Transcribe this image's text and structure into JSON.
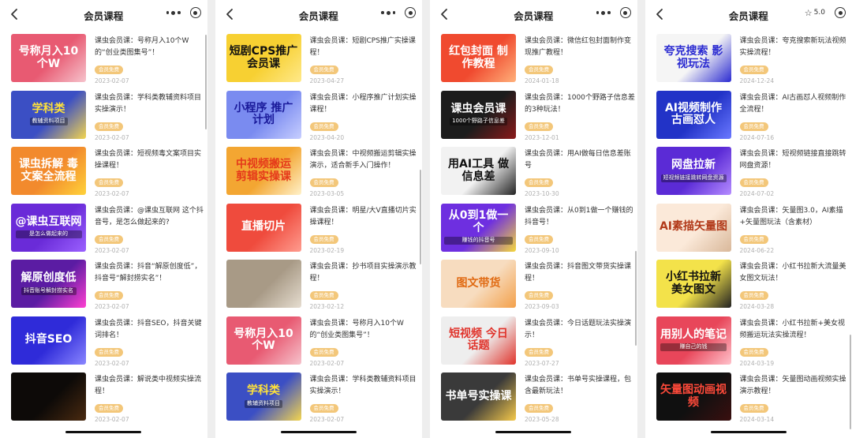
{
  "panels": [
    {
      "title": "会员课程",
      "rating": null,
      "scroll": 0.0,
      "items": [
        {
          "desc": "课虫会员课：号称月入10个W的“创业类图集号”！",
          "tag": "会员免费",
          "date": "2023-02-07",
          "thumb_text": "号称月入10个W",
          "thumb_sub": "",
          "thumb_bg": "#e85a72",
          "thumb_bg2": "#f6c3cc",
          "thumb_fg": "#ffffff"
        },
        {
          "desc": "课虫会员课：学科类教辅资料项目实操演示！",
          "tag": "会员免费",
          "date": "2023-02-07",
          "thumb_text": "学科类",
          "thumb_sub": "教辅资料项目",
          "thumb_bg": "#3b4fc4",
          "thumb_bg2": "#f3d54e",
          "thumb_fg": "#ffe23a"
        },
        {
          "desc": "课虫会员课：短视频毒文案项目实操课程！",
          "tag": "会员免费",
          "date": "2023-02-07",
          "thumb_text": "课虫拆解 毒文案全流程",
          "thumb_sub": "",
          "thumb_bg": "#f28a2d",
          "thumb_bg2": "#ffd23a",
          "thumb_fg": "#ffffff"
        },
        {
          "desc": "课虫会员课：@课虫互联网 这个抖音号，是怎么做起来的?",
          "tag": "会员免费",
          "date": "2023-02-07",
          "thumb_text": "@课虫互联网",
          "thumb_sub": "是怎么做起来的",
          "thumb_bg": "#6a2bd8",
          "thumb_bg2": "#9b61ff",
          "thumb_fg": "#ffffff"
        },
        {
          "desc": "课虫会员课：抖音“解原创度低”，抖音号“解封捞实名”！",
          "tag": "会员免费",
          "date": "2023-02-07",
          "thumb_text": "解原创度低",
          "thumb_sub": "抖音账号解封捞实名",
          "thumb_bg": "#5b1ca3",
          "thumb_bg2": "#ff3fd1",
          "thumb_fg": "#ffffff"
        },
        {
          "desc": "课虫会员课：抖音SEO，抖音关键词排名！",
          "tag": "会员免费",
          "date": "2023-02-07",
          "thumb_text": "抖音SEO",
          "thumb_sub": "",
          "thumb_bg": "#2f2bd9",
          "thumb_bg2": "#8a86ff",
          "thumb_fg": "#ffffff"
        },
        {
          "desc": "课虫会员课：解说类中视频实操流程！",
          "tag": "会员免费",
          "date": "2023-02-07",
          "thumb_text": "",
          "thumb_sub": "",
          "thumb_bg": "#0d0a08",
          "thumb_bg2": "#4a2a10",
          "thumb_fg": "#ffffff"
        }
      ]
    },
    {
      "title": "会员课程",
      "rating": null,
      "scroll": 0.45,
      "items": [
        {
          "desc": "课虫会员课：短剧CPS推广实操课程！",
          "tag": "会员免费",
          "date": "2023-04-27",
          "thumb_text": "短剧CPS推广 会员课",
          "thumb_sub": "",
          "thumb_bg": "#f7d032",
          "thumb_bg2": "#ffe98a",
          "thumb_fg": "#111111"
        },
        {
          "desc": "课虫会员课：小程序推广计划实操课程！",
          "tag": "会员免费",
          "date": "2023-04-20",
          "thumb_text": "小程序 推广计划",
          "thumb_sub": "",
          "thumb_bg": "#7a8bf0",
          "thumb_bg2": "#c7ceff",
          "thumb_fg": "#1a1a9a"
        },
        {
          "desc": "课虫会员课：中视频搬运剪辑实操演示，适合新手入门操作！",
          "tag": "会员免费",
          "date": "2023-03-05",
          "thumb_text": "中视频搬运 剪辑实操课",
          "thumb_sub": "",
          "thumb_bg": "#f3a632",
          "thumb_bg2": "#fff1c9",
          "thumb_fg": "#e53a1a"
        },
        {
          "desc": "课虫会员课：明星/大V直播切片实操课程！",
          "tag": "会员免费",
          "date": "2023-02-19",
          "thumb_text": "直播切片",
          "thumb_sub": "",
          "thumb_bg": "#ef4b3d",
          "thumb_bg2": "#ff9c8f",
          "thumb_fg": "#ffffff"
        },
        {
          "desc": "课虫会员课：抄书项目实操演示教程！",
          "tag": "会员免费",
          "date": "2023-02-12",
          "thumb_text": "",
          "thumb_sub": "",
          "thumb_bg": "#a89a86",
          "thumb_bg2": "#e6ddd0",
          "thumb_fg": "#ffffff"
        },
        {
          "desc": "课虫会员课：号称月入10个W的“创业类图集号”！",
          "tag": "会员免费",
          "date": "2023-02-07",
          "thumb_text": "号称月入10个W",
          "thumb_sub": "",
          "thumb_bg": "#e85a72",
          "thumb_bg2": "#f6c3cc",
          "thumb_fg": "#ffffff"
        },
        {
          "desc": "课虫会员课：学科类教辅资料项目实操演示！",
          "tag": "会员免费",
          "date": "2023-02-07",
          "thumb_text": "学科类",
          "thumb_sub": "教辅资料项目",
          "thumb_bg": "#3b4fc4",
          "thumb_bg2": "#f3d54e",
          "thumb_fg": "#ffe23a"
        }
      ]
    },
    {
      "title": "会员课程",
      "rating": null,
      "scroll": 0.72,
      "items": [
        {
          "desc": "课虫会员课：微信红包封面制作变现推广教程！",
          "tag": "会员免费",
          "date": "2024-01-18",
          "thumb_text": "红包封面 制作教程",
          "thumb_sub": "",
          "thumb_bg": "#f04a2f",
          "thumb_bg2": "#ffb07a",
          "thumb_fg": "#ffffff"
        },
        {
          "desc": "课虫会员课：1000个野路子信息差的3种玩法！",
          "tag": "会员免费",
          "date": "2023-12-01",
          "thumb_text": "课虫会员课",
          "thumb_sub": "1000个野路子信息差",
          "thumb_bg": "#1c1c1c",
          "thumb_bg2": "#8b1a1a",
          "thumb_fg": "#ffffff"
        },
        {
          "desc": "课虫会员课：用AI做每日信息差账号",
          "tag": "会员免费",
          "date": "2023-10-30",
          "thumb_text": "用AI工具 做信息差",
          "thumb_sub": "",
          "thumb_bg": "#f2f2f2",
          "thumb_bg2": "#222222",
          "thumb_fg": "#111111"
        },
        {
          "desc": "课虫会员课：从0到1做一个赚钱的抖音号！",
          "tag": "会员免费",
          "date": "2023-09-10",
          "thumb_text": "从0到1做一个",
          "thumb_sub": "赚钱的抖音号",
          "thumb_bg": "#6e2fe0",
          "thumb_bg2": "#f6d83a",
          "thumb_fg": "#ffffff"
        },
        {
          "desc": "课虫会员课：抖音图文带货实操课程！",
          "tag": "会员免费",
          "date": "2023-09-03",
          "thumb_text": "图文带货",
          "thumb_sub": "",
          "thumb_bg": "#f7dcbf",
          "thumb_bg2": "#f3a04a",
          "thumb_fg": "#e06a12"
        },
        {
          "desc": "课虫会员课：今日话题玩法实操演示！",
          "tag": "会员免费",
          "date": "2023-07-27",
          "thumb_text": "短视频 今日话题",
          "thumb_sub": "",
          "thumb_bg": "#eeeeee",
          "thumb_bg2": "#e0332b",
          "thumb_fg": "#e0332b"
        },
        {
          "desc": "课虫会员课：书单号实操课程，包含最新玩法！",
          "tag": "会员免费",
          "date": "2023-05-28",
          "thumb_text": "书单号实操课",
          "thumb_sub": "",
          "thumb_bg": "#3a3a3a",
          "thumb_bg2": "#f5c94a",
          "thumb_fg": "#ffffff"
        }
      ]
    },
    {
      "title": "会员课程",
      "rating": "5.0",
      "scroll": 1.0,
      "items": [
        {
          "desc": "课虫会员课：夸克搜索新玩法视频实操流程！",
          "tag": "会员免费",
          "date": "2024-12-24",
          "thumb_text": "夸克搜索 影视玩法",
          "thumb_sub": "",
          "thumb_bg": "#f5f5f5",
          "thumb_bg2": "#2b2bd1",
          "thumb_fg": "#2b2bd1"
        },
        {
          "desc": "课虫会员课：AI古画怼人视频制作全流程！",
          "tag": "会员免费",
          "date": "2024-07-16",
          "thumb_text": "AI视频制作 古画怼人",
          "thumb_sub": "",
          "thumb_bg": "#2233c7",
          "thumb_bg2": "#6a78ff",
          "thumb_fg": "#ffffff"
        },
        {
          "desc": "课虫会员课：短视频链接直接跳转网盘资源！",
          "tag": "会员免费",
          "date": "2024-07-02",
          "thumb_text": "网盘拉新",
          "thumb_sub": "短视频链接跳转网盘资源",
          "thumb_bg": "#5b2bd6",
          "thumb_bg2": "#b58cff",
          "thumb_fg": "#ffffff"
        },
        {
          "desc": "课虫会员课：矢量图3.0，AI素描+矢量图玩法（含素材）",
          "tag": "会员免费",
          "date": "2024-06-22",
          "thumb_text": "AI素描矢量图",
          "thumb_sub": "",
          "thumb_bg": "#fbe9d9",
          "thumb_bg2": "#d9b89a",
          "thumb_fg": "#b23a1a"
        },
        {
          "desc": "课虫会员课：小红书拉新大流量美女图文玩法！",
          "tag": "会员免费",
          "date": "2024-03-28",
          "thumb_text": "小红书拉新 美女图文",
          "thumb_sub": "",
          "thumb_bg": "#f3e24a",
          "thumb_bg2": "#222222",
          "thumb_fg": "#111111"
        },
        {
          "desc": "课虫会员课：小红书拉新+美女视频搬运玩法实操流程！",
          "tag": "会员免费",
          "date": "2024-03-19",
          "thumb_text": "用别人的笔记",
          "thumb_sub": "赚自己的钱",
          "thumb_bg": "#e8465a",
          "thumb_bg2": "#ffc2cb",
          "thumb_fg": "#ffffff"
        },
        {
          "desc": "课虫会员课：矢量图动画视频实操演示教程！",
          "tag": "会员免费",
          "date": "2024-03-14",
          "thumb_text": "矢量图动画视频",
          "thumb_sub": "",
          "thumb_bg": "#101010",
          "thumb_bg2": "#3a0f0f",
          "thumb_fg": "#ff4a3a"
        }
      ]
    }
  ]
}
